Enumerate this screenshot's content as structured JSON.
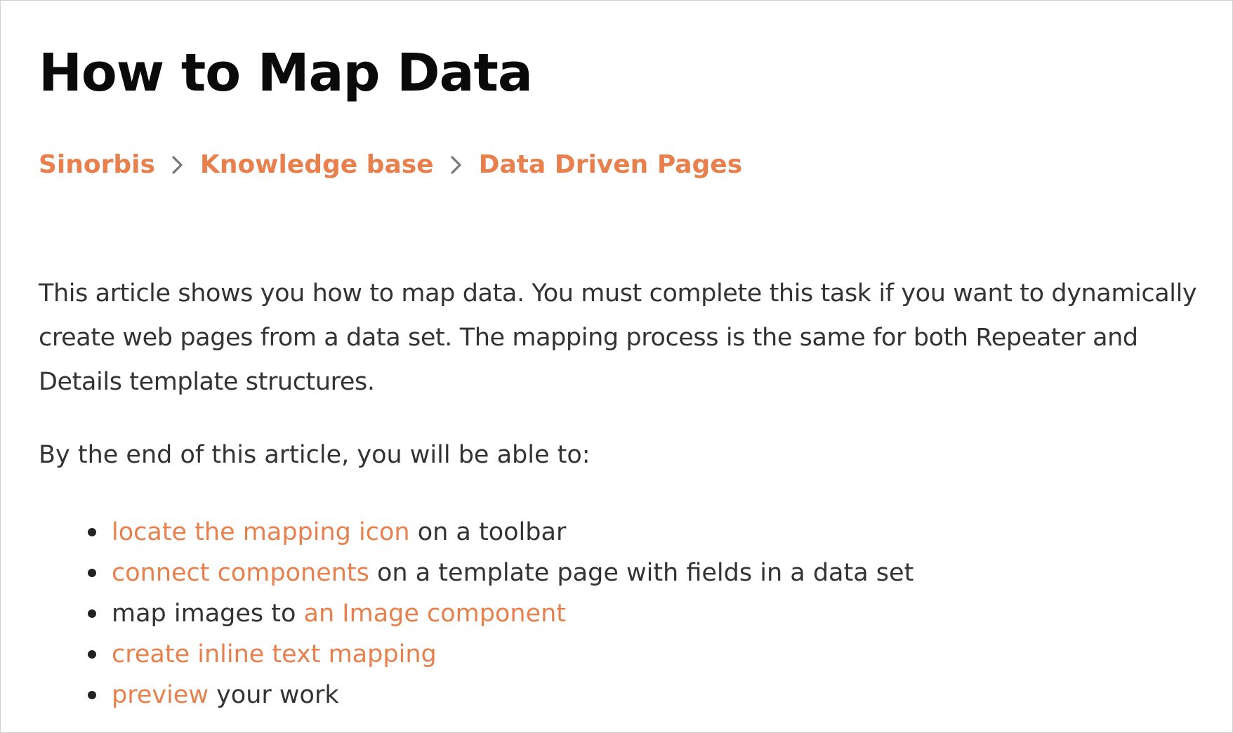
{
  "page": {
    "title": "How to Map Data"
  },
  "breadcrumb": {
    "items": [
      "Sinorbis",
      "Knowledge base",
      "Data Driven Pages"
    ],
    "separator_icon": "chevron-right-icon"
  },
  "article": {
    "intro": "This article shows you how to map data. You must complete this task if you want to dynamically create web pages from a data set. The mapping process is the same for both Repeater and Details template structures.",
    "lead": "By the end of this article, you will be able to:",
    "objectives": [
      {
        "link_before": "",
        "link": "locate the mapping icon",
        "rest": " on a toolbar"
      },
      {
        "link_before": "",
        "link": "connect components",
        "rest": " on a template page with fields in a data set"
      },
      {
        "link_before": "map images to ",
        "link": "an Image component",
        "rest": ""
      },
      {
        "link_before": "",
        "link": "create inline text mapping",
        "rest": ""
      },
      {
        "link_before": "",
        "link": "preview",
        "rest": " your work"
      }
    ]
  },
  "colors": {
    "accent": "#e8804d",
    "heading": "#0a0a0a",
    "body_text": "#333333",
    "border": "#cfcfcf"
  }
}
